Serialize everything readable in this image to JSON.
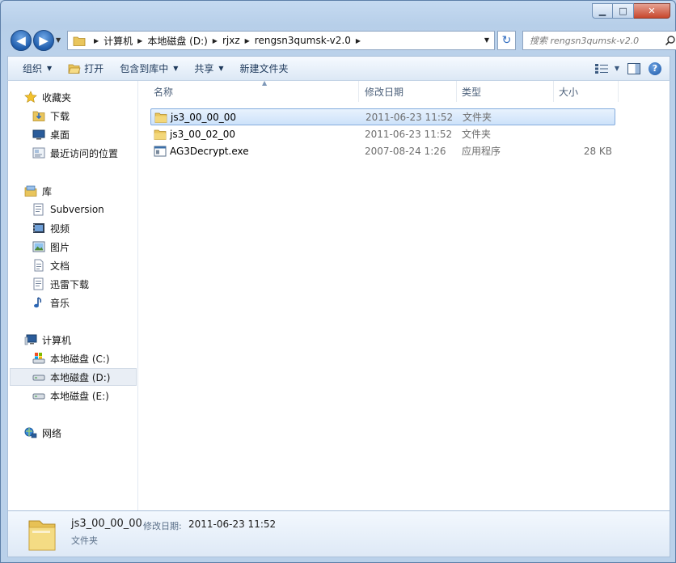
{
  "window": {
    "caption": {
      "minimize": "▁",
      "maximize": "□",
      "close": "✕"
    }
  },
  "nav": {
    "back_icon": "◀",
    "forward_icon": "▶",
    "dropdown_icon": "▼"
  },
  "address": {
    "crumbs": [
      "计算机",
      "本地磁盘 (D:)",
      "rjxz",
      "rengsn3qumsk-v2.0"
    ],
    "refresh_icon": "↻"
  },
  "search": {
    "placeholder": "搜索 rengsn3qumsk-v2.0",
    "icon": "search-icon"
  },
  "toolbar": {
    "organize": "组织",
    "open": "打开",
    "include_library": "包含到库中",
    "share": "共享",
    "new_folder": "新建文件夹",
    "help": "?"
  },
  "sidebar": {
    "favorites": "收藏夹",
    "downloads": "下载",
    "desktop": "桌面",
    "recent": "最近访问的位置",
    "libraries": "库",
    "subversion": "Subversion",
    "videos": "视频",
    "pictures": "图片",
    "documents": "文档",
    "xunlei": "迅雷下载",
    "music": "音乐",
    "computer": "计算机",
    "drive_c": "本地磁盘 (C:)",
    "drive_d": "本地磁盘 (D:)",
    "drive_e": "本地磁盘 (E:)",
    "network": "网络"
  },
  "columns": {
    "name": "名称",
    "date": "修改日期",
    "type": "类型",
    "size": "大小"
  },
  "files": [
    {
      "name": "js3_00_00_00",
      "date": "2011-06-23 11:52",
      "type": "文件夹",
      "size": "",
      "icon": "folder-icon",
      "selected": true
    },
    {
      "name": "js3_00_02_00",
      "date": "2011-06-23 11:52",
      "type": "文件夹",
      "size": "",
      "icon": "folder-icon",
      "selected": false
    },
    {
      "name": "AG3Decrypt.exe",
      "date": "2007-08-24 1:26",
      "type": "应用程序",
      "size": "28 KB",
      "icon": "exe-icon",
      "selected": false
    }
  ],
  "details": {
    "name": "js3_00_00_00",
    "modified_label": "修改日期:",
    "modified_value": "2011-06-23 11:52",
    "type": "文件夹"
  },
  "colors": {
    "accent": "#3d7bd9",
    "selection_bg": "#cde2fa",
    "folder": "#e8c65a"
  }
}
